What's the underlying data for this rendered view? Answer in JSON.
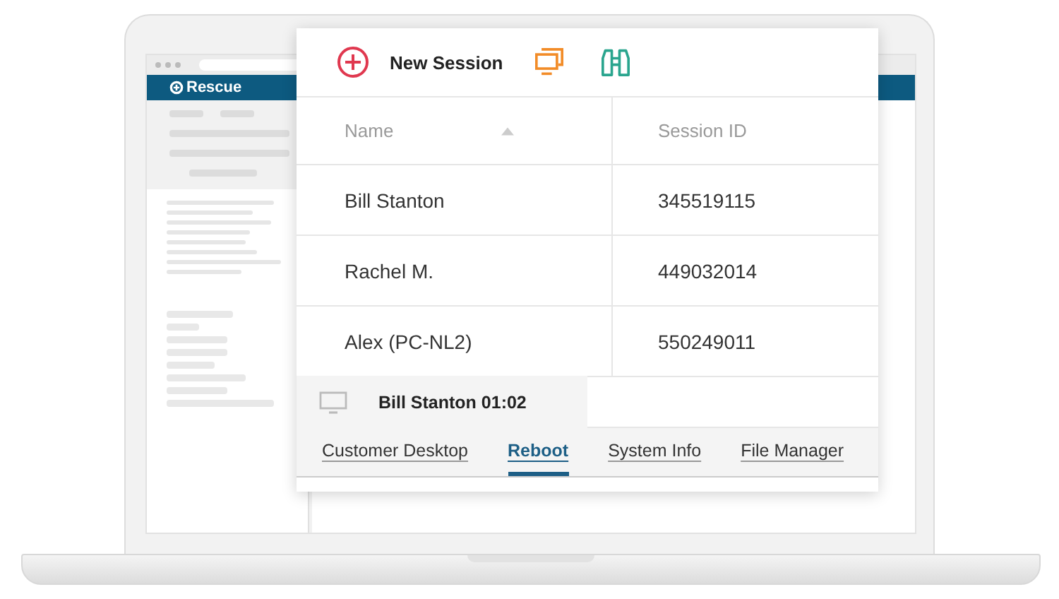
{
  "logo": {
    "text": "Rescue"
  },
  "toolbar": {
    "new_session": "New Session"
  },
  "table": {
    "columns": [
      {
        "label": "Name",
        "sorted": true
      },
      {
        "label": "Session ID",
        "sorted": false
      }
    ],
    "rows": [
      {
        "name": "Bill Stanton",
        "session_id": "345519115"
      },
      {
        "name": "Rachel M.",
        "session_id": "449032014"
      },
      {
        "name": "Alex (PC-NL2)",
        "session_id": "550249011"
      }
    ]
  },
  "session_tab": {
    "title": "Bill Stanton 01:02"
  },
  "tabs": [
    {
      "label": "Customer Desktop",
      "selected": false
    },
    {
      "label": "Reboot",
      "selected": true
    },
    {
      "label": "System Info",
      "selected": false
    },
    {
      "label": "File Manager",
      "selected": false
    }
  ]
}
